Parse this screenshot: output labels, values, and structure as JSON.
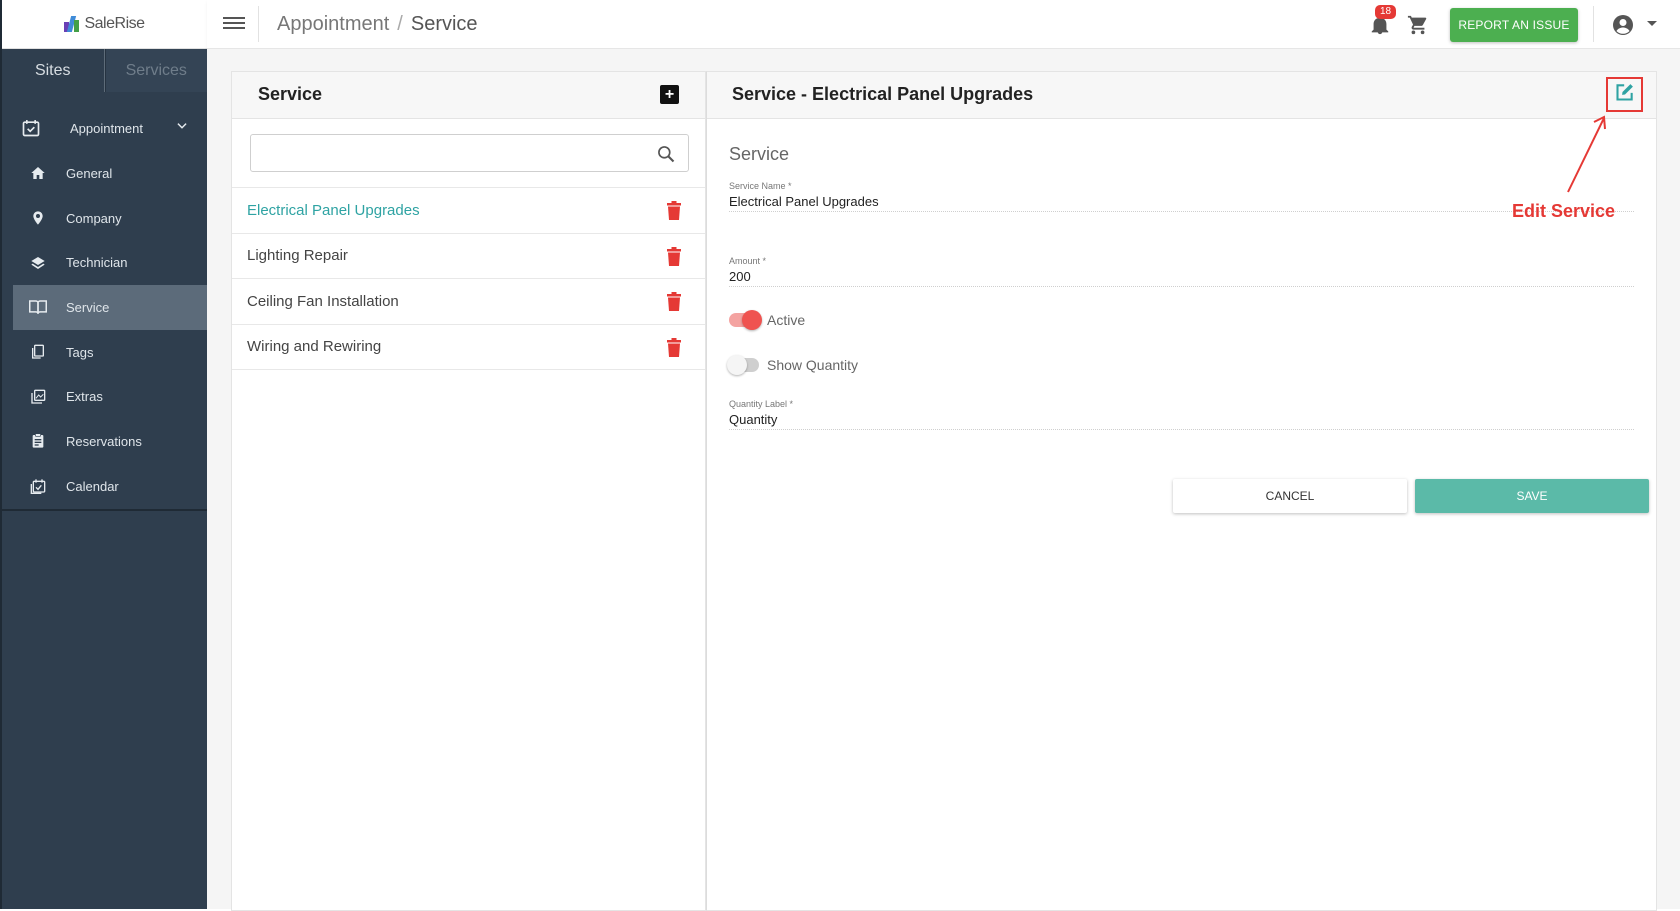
{
  "app": {
    "logo_text": "SaleRise"
  },
  "sidebar": {
    "tabs": [
      {
        "label": "Sites"
      },
      {
        "label": "Services"
      }
    ],
    "items": [
      {
        "label": "Appointment",
        "icon": "calendar-check-icon"
      },
      {
        "label": "General",
        "icon": "home-icon"
      },
      {
        "label": "Company",
        "icon": "location-pin-icon"
      },
      {
        "label": "Technician",
        "icon": "layers-icon"
      },
      {
        "label": "Service",
        "icon": "book-open-icon"
      },
      {
        "label": "Tags",
        "icon": "tags-icon"
      },
      {
        "label": "Extras",
        "icon": "gallery-icon"
      },
      {
        "label": "Reservations",
        "icon": "clipboard-icon"
      },
      {
        "label": "Calendar",
        "icon": "calendar-icon"
      }
    ]
  },
  "topbar": {
    "breadcrumb": {
      "parent": "Appointment",
      "separator": "/",
      "current": "Service"
    },
    "notification_count": "18",
    "report_label": "REPORT AN ISSUE",
    "accent_color": "#4caf50"
  },
  "list_panel": {
    "title": "Service",
    "search_placeholder": "",
    "items": [
      {
        "name": "Electrical Panel Upgrades"
      },
      {
        "name": "Lighting Repair"
      },
      {
        "name": "Ceiling Fan Installation"
      },
      {
        "name": "Wiring and Rewiring"
      }
    ]
  },
  "detail_panel": {
    "title": "Service - Electrical Panel Upgrades",
    "section_title": "Service",
    "fields": {
      "service_name": {
        "label": "Service Name *",
        "value": "Electrical Panel Upgrades"
      },
      "amount": {
        "label": "Amount *",
        "value": "200"
      },
      "quantity_label": {
        "label": "Quantity Label *",
        "value": "Quantity"
      }
    },
    "toggles": {
      "active": {
        "label": "Active",
        "on": true
      },
      "show_quantity": {
        "label": "Show Quantity",
        "on": false
      }
    },
    "cancel_label": "CANCEL",
    "save_label": "SAVE"
  },
  "annotation": {
    "label": "Edit Service",
    "color": "#e53935"
  }
}
